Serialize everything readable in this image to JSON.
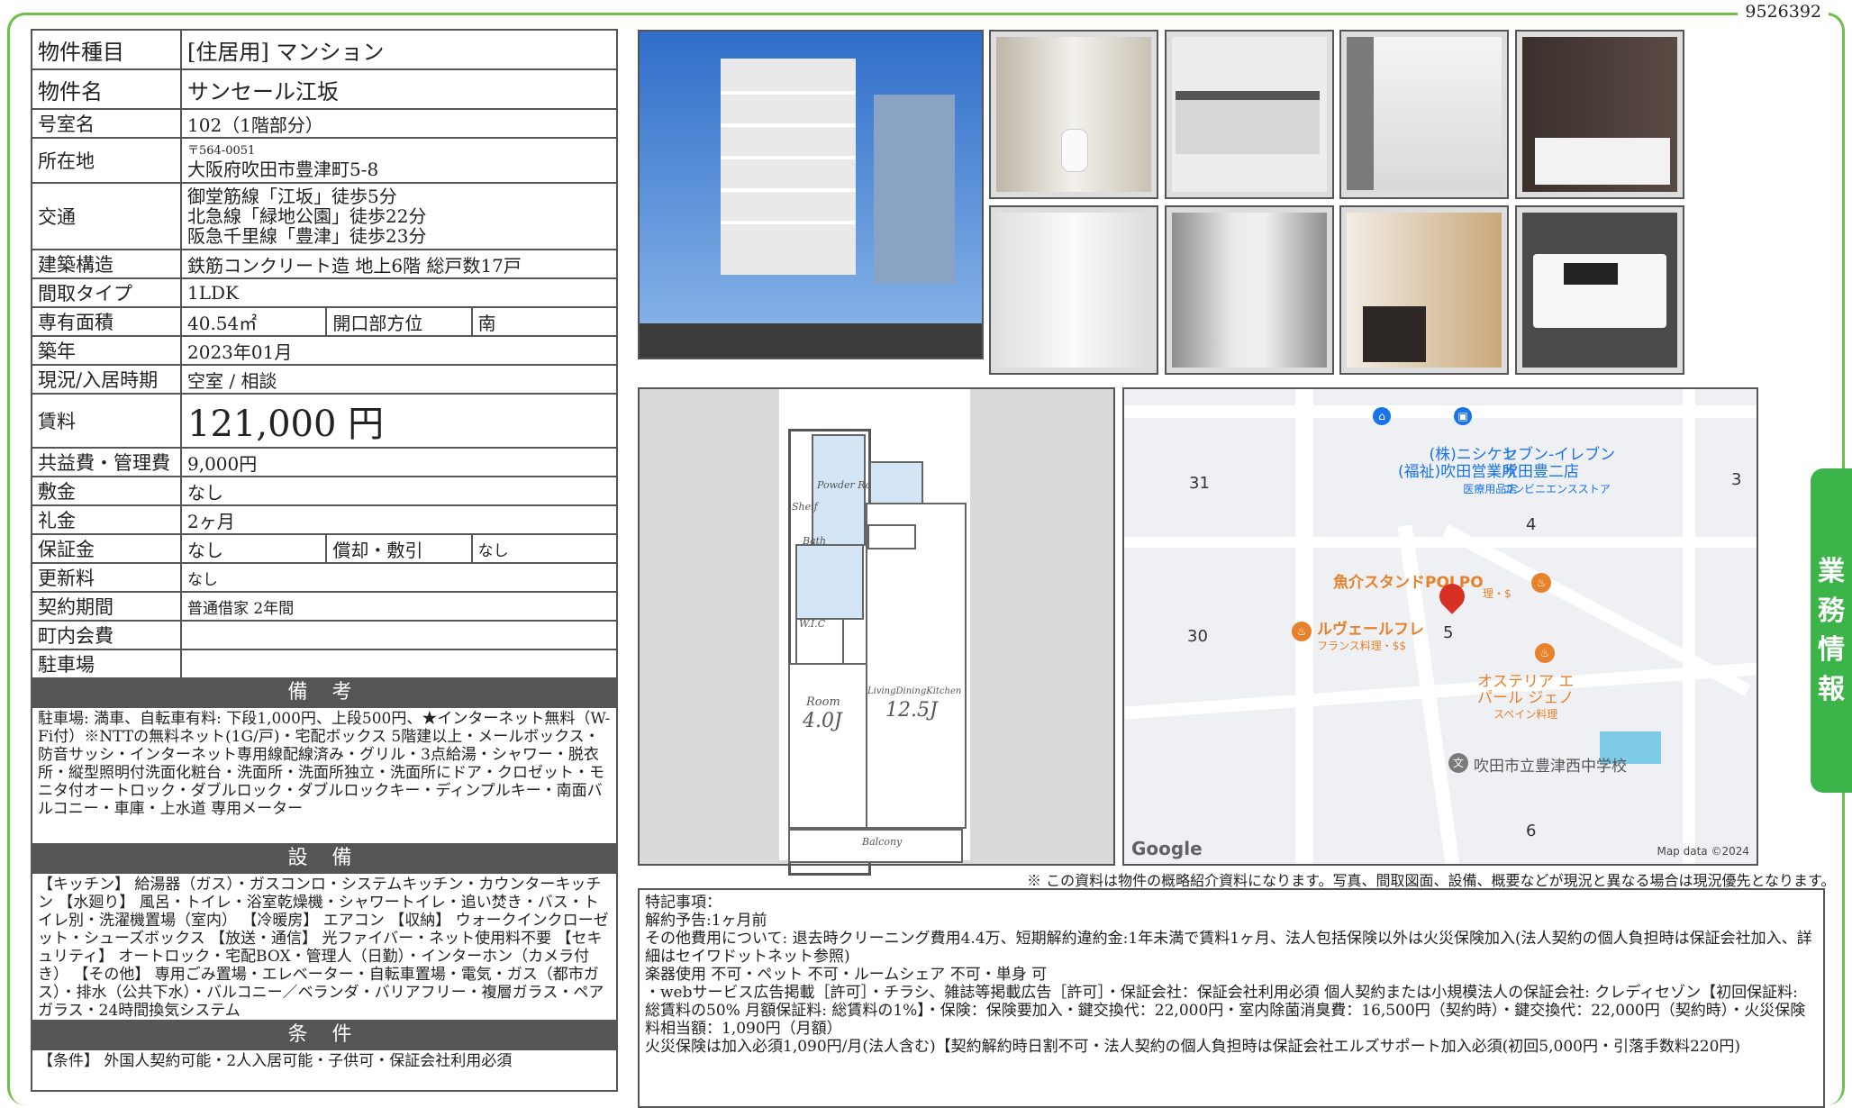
{
  "doc_id": "9526392",
  "side_tab": [
    "業",
    "務",
    "情",
    "報"
  ],
  "spec": {
    "type_label": "物件種目",
    "type_value": "[住居用] マンション",
    "name_label": "物件名",
    "name_value": "サンセール江坂",
    "room_label": "号室名",
    "room_value": "102（1階部分）",
    "addr_label": "所在地",
    "addr_zip": "〒564-0051",
    "addr_value": "大阪府吹田市豊津町5-8",
    "transit_label": "交通",
    "transit": [
      "御堂筋線「江坂」徒歩5分",
      "北急線「緑地公園」徒歩22分",
      "阪急千里線「豊津」徒歩23分"
    ],
    "structure_label": "建築構造",
    "structure_value": "鉄筋コンクリート造 地上6階 総戸数17戸",
    "layout_label": "間取タイプ",
    "layout_value": "1LDK",
    "area_label": "専有面積",
    "area_value": "40.54㎡",
    "facing_label": "開口部方位",
    "facing_value": "南",
    "built_label": "築年",
    "built_value": "2023年01月",
    "status_label": "現況/入居時期",
    "status_value": "空室 / 相談",
    "rent_label": "賃料",
    "rent_value": "121,000 円",
    "fee_label": "共益費・管理費",
    "fee_value": "9,000円",
    "deposit_label": "敷金",
    "deposit_value": "なし",
    "key_label": "礼金",
    "key_value": "2ヶ月",
    "guarantee_label": "保証金",
    "guarantee_value": "なし",
    "amort_label": "償却・敷引",
    "amort_value": "なし",
    "renew_label": "更新料",
    "renew_value": "なし",
    "contract_label": "契約期間",
    "contract_value": "普通借家 2年間",
    "assoc_label": "町内会費",
    "assoc_value": "",
    "parking_label": "駐車場",
    "parking_value": ""
  },
  "remarks": {
    "title": "備 考",
    "text": "駐車場: 満車、自転車有料: 下段1,000円、上段500円、★インターネット無料（W-Fi付）※NTTの無料ネット(1G/戸)・宅配ボックス 5階建以上・メールボックス・防音サッシ・インターネット専用線配線済み・グリル・3点給湯・シャワー・脱衣所・縦型照明付洗面化粧台・洗面所・洗面所独立・洗面所にドア・クロゼット・モニタ付オートロック・ダブルロック・ダブルロックキー・ディンプルキー・南面バルコニー・車庫・上水道 専用メーター"
  },
  "equipment": {
    "title": "設 備",
    "text": "【キッチン】 給湯器（ガス）・ガスコンロ・システムキッチン・カウンターキッチン 【水廻り】 風呂・トイレ・浴室乾燥機・シャワートイレ・追い焚き・バス・トイレ別・洗濯機置場（室内） 【冷暖房】 エアコン 【収納】 ウォークインクローゼット・シューズボックス 【放送・通信】 光ファイバー・ネット使用料不要 【セキュリティ】 オートロック・宅配BOX・管理人（日勤）・インターホン（カメラ付き） 【その他】 専用ごみ置場・エレベーター・自転車置場・電気・ガス（都市ガス）・排水（公共下水）・バルコニー／ベランダ・バリアフリー・複層ガラス・ペアガラス・24時間換気システム"
  },
  "conditions": {
    "title": "条 件",
    "text": "【条件】 外国人契約可能・2人入居可能・子供可・保証会社利用必須"
  },
  "plan": {
    "room_label": "Room",
    "room_size": "4.0J",
    "ldk_label": "LivingDiningKitchen",
    "ldk_size": "12.5J",
    "balcony": "Balcony",
    "wic": "W.I.C",
    "bath": "Bath",
    "powder": "Powder Room",
    "shelf": "Shelf"
  },
  "map": {
    "labels": {
      "n31": "31",
      "n3": "3",
      "n4": "4",
      "n30": "30",
      "n5": "5",
      "n6": "6",
      "poi1a": "(株)ニシケン",
      "poi1b": "(福祉)吹田営業所",
      "poi1c": "医療用品店",
      "poi2a": "セブン-イレブン",
      "poi2b": "吹田豊二店",
      "poi2c": "コンビニエンスストア",
      "poi3": "魚介スタンドPOLPO",
      "poi3b": "理・$",
      "poi4": "ルヴェールフレ",
      "poi4b": "フランス料理・$$",
      "poi5a": "オステリア エ",
      "poi5b": "パール ジェノ",
      "poi5c": "スペイン料理",
      "school": "吹田市立豊津西中学校",
      "google": "Google",
      "mapdata": "Map data ©2024"
    },
    "accent": "#e8812b",
    "pin": "#d93025",
    "blue": "#1a73e8"
  },
  "notice": "※ この資料は物件の概略紹介資料になります。写真、間取図面、設備、概要などが現況と異なる場合は現況優先となります。",
  "special": {
    "lines": [
      "特記事項：",
      "解約予告:1ヶ月前",
      "その他費用について: 退去時クリーニング費用4.4万、短期解約違約金:1年未満で賃料1ヶ月、法人包括保険以外は火災保険加入(法人契約の個人負担時は保証会社加入、詳細はセイワドットネット参照)",
      "楽器使用 不可・ペット 不可・ルームシェア 不可・単身 可",
      "・webサービス広告掲載［許可］・チラシ、雑誌等掲載広告［許可］・保証会社：保証会社利用必須 個人契約または小規模法人の保証会社: クレディセゾン【初回保証料: 総賃料の50% 月額保証料: 総賃料の1%】・保険：保険要加入・鍵交換代：22,000円・室内除菌消臭費：16,500円（契約時）・鍵交換代：22,000円（契約時）・火災保険料相当額：1,090円（月額）",
      "火災保険は加入必須1,090円/月(法人含む)【契約解約時日割不可・法人契約の個人負担時は保証会社エルズサポート加入必須(初回5,000円・引落手数料220円)"
    ]
  }
}
